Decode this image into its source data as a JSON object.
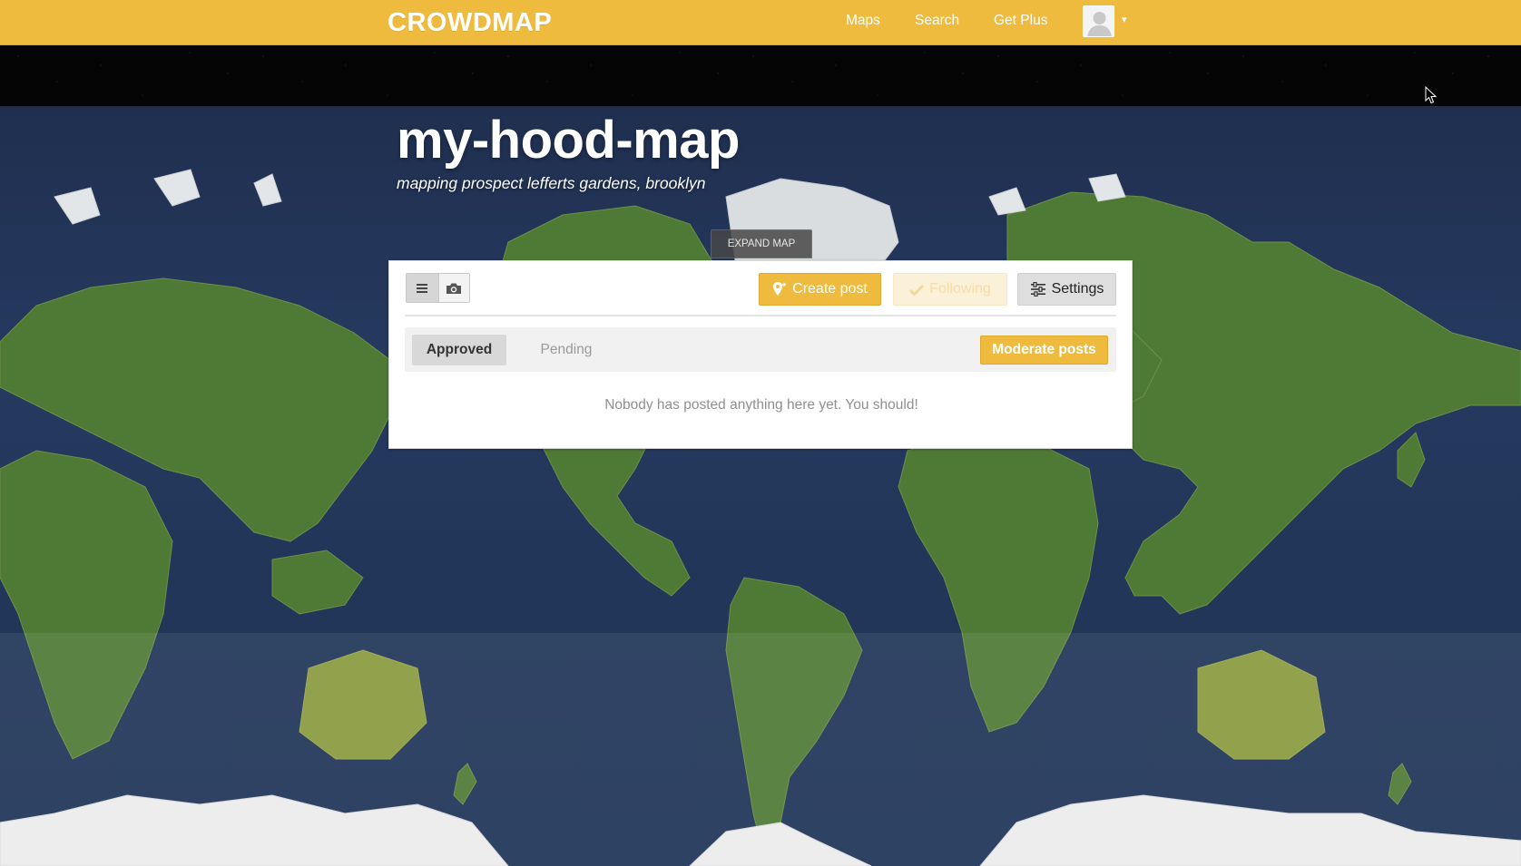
{
  "brand": {
    "logo_text": "CROWDMAP"
  },
  "nav": {
    "items": [
      {
        "label": "Maps"
      },
      {
        "label": "Search"
      },
      {
        "label": "Get Plus"
      }
    ],
    "user_menu_caret": "▾"
  },
  "map": {
    "title": "my-hood-map",
    "subtitle": "mapping prospect lefferts gardens, brooklyn",
    "expand_label": "EXPAND MAP"
  },
  "toolbar": {
    "view_modes": [
      {
        "icon": "list-icon",
        "active": true
      },
      {
        "icon": "camera-icon",
        "active": false
      }
    ],
    "create_post_label": "Create post",
    "following_label": "Following",
    "settings_label": "Settings"
  },
  "posts": {
    "tabs": [
      {
        "label": "Approved",
        "active": true
      },
      {
        "label": "Pending",
        "active": false
      }
    ],
    "moderate_label": "Moderate posts",
    "empty_message": "Nobody has posted anything here yet. You should!"
  },
  "colors": {
    "brand_yellow": "#efbb3e",
    "ocean": "#223659",
    "land": "#4f7a35",
    "ice": "#ececec"
  }
}
